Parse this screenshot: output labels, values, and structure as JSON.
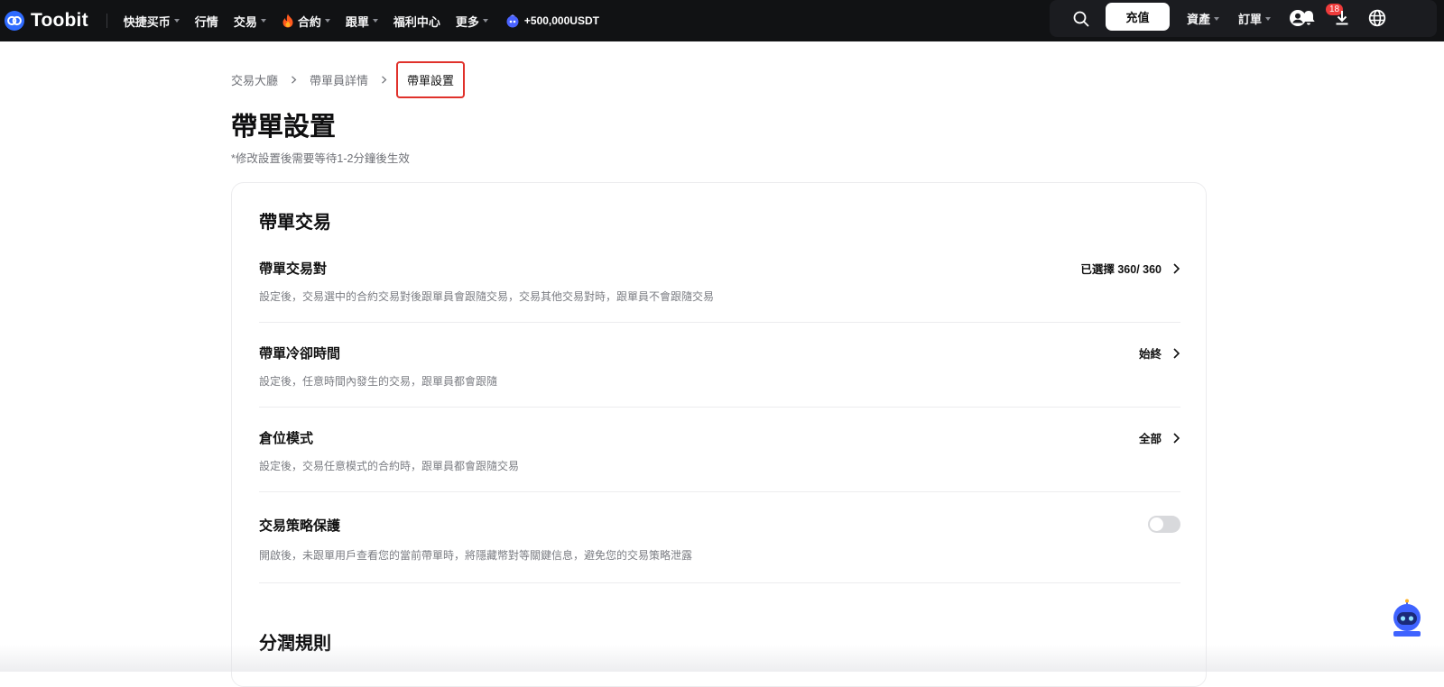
{
  "brand": {
    "name": "Toobit"
  },
  "nav": {
    "items": [
      {
        "label": "快捷买币",
        "dropdown": true
      },
      {
        "label": "行情",
        "dropdown": false
      },
      {
        "label": "交易",
        "dropdown": true
      },
      {
        "label": "合約",
        "dropdown": true,
        "icon": "fire-icon"
      },
      {
        "label": "跟單",
        "dropdown": true
      },
      {
        "label": "福利中心",
        "dropdown": false
      },
      {
        "label": "更多",
        "dropdown": true
      }
    ],
    "promo": "+500,000USDT"
  },
  "header_right": {
    "deposit_label": "充值",
    "assets_label": "資產",
    "orders_label": "訂單",
    "notification_count": "18",
    "icons": [
      "search-icon",
      "user-icon",
      "bell-icon",
      "download-icon",
      "globe-icon"
    ]
  },
  "breadcrumb": {
    "items": [
      "交易大廳",
      "帶單員詳情"
    ],
    "current": "帶單設置"
  },
  "page": {
    "title": "帶單設置",
    "note": "*修改設置後需要等待1-2分鐘後生效"
  },
  "card": {
    "section1_title": "帶單交易",
    "rows": [
      {
        "title": "帶單交易對",
        "desc": "設定後，交易選中的合約交易對後跟單員會跟隨交易，交易其他交易對時，跟單員不會跟隨交易",
        "value": "已選擇 360/ 360"
      },
      {
        "title": "帶單冷卻時間",
        "desc": "設定後，任意時間內發生的交易，跟單員都會跟隨",
        "value": "始終"
      },
      {
        "title": "倉位模式",
        "desc": "設定後，交易任意模式的合約時，跟單員都會跟隨交易",
        "value": "全部"
      },
      {
        "title": "交易策略保護",
        "desc": "開啟後，未跟單用戶查看您的當前帶單時，將隱藏幣對等關鍵信息，避免您的交易策略泄露",
        "toggle_on": false
      }
    ],
    "section2_title": "分潤規則"
  },
  "colors": {
    "nav_bg": "#111214",
    "accent_red": "#e0312b",
    "brand_blue": "#2f6bff"
  }
}
